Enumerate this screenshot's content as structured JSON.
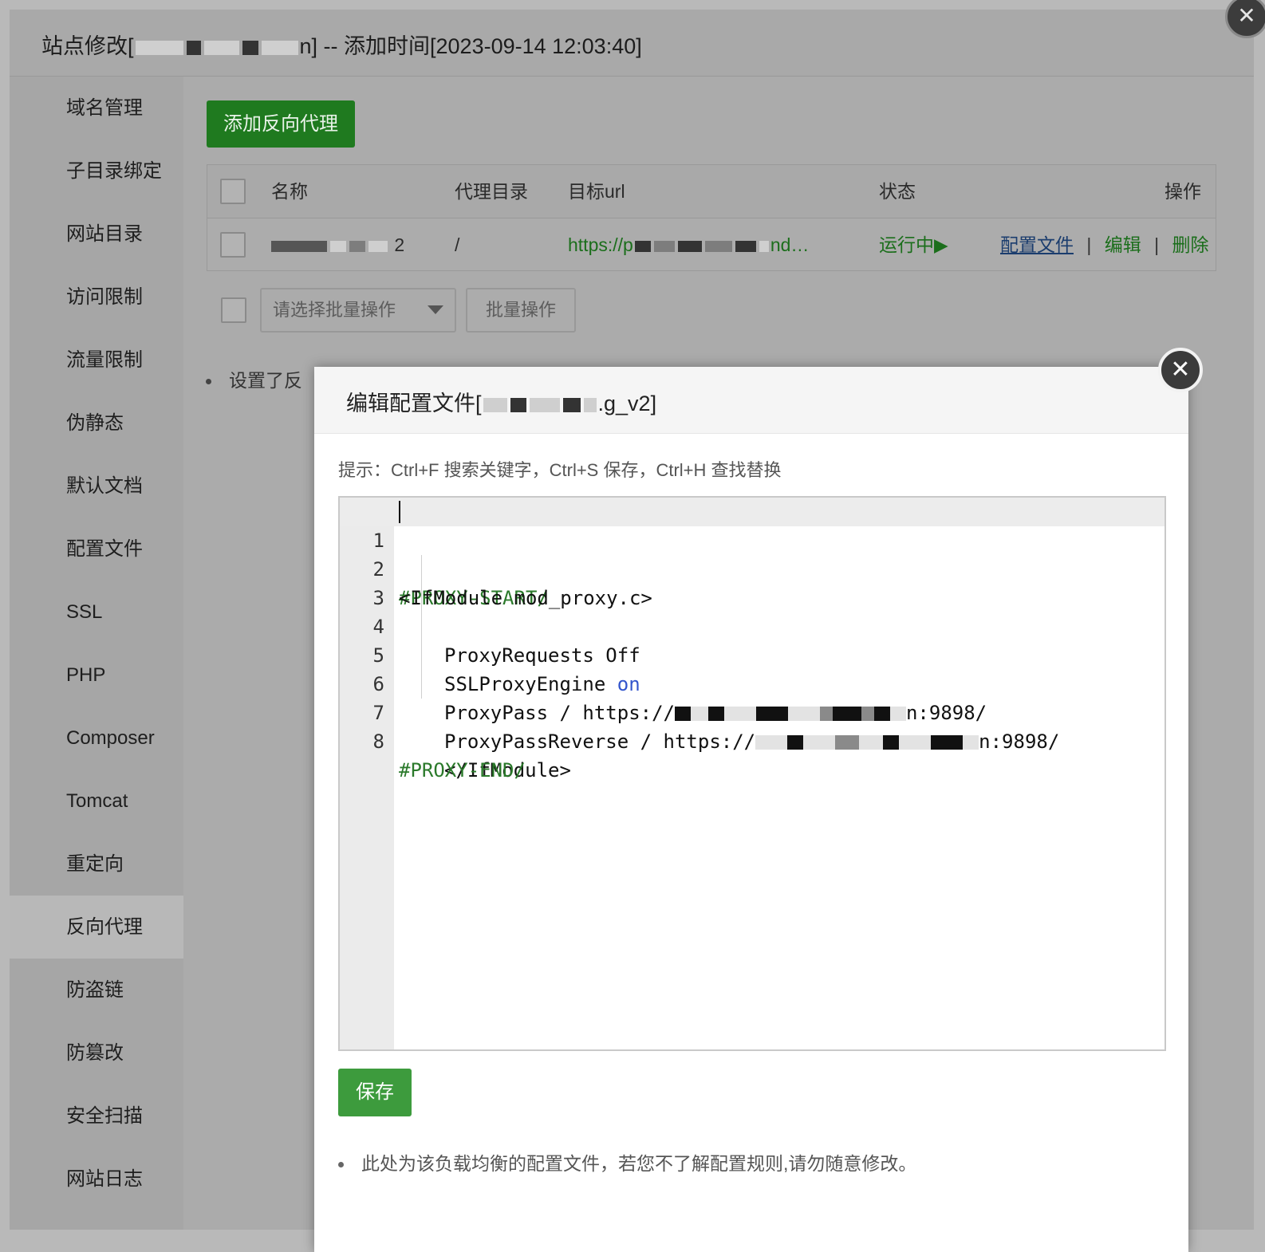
{
  "site_window": {
    "title_prefix": "站点修改[",
    "title_suffix": "n] -- 添加时间[2023-09-14 12:03:40]",
    "close_glyph": "✕"
  },
  "sidebar": {
    "items": [
      {
        "label": "域名管理"
      },
      {
        "label": "子目录绑定"
      },
      {
        "label": "网站目录"
      },
      {
        "label": "访问限制"
      },
      {
        "label": "流量限制"
      },
      {
        "label": "伪静态"
      },
      {
        "label": "默认文档"
      },
      {
        "label": "配置文件"
      },
      {
        "label": "SSL"
      },
      {
        "label": "PHP"
      },
      {
        "label": "Composer"
      },
      {
        "label": "Tomcat"
      },
      {
        "label": "重定向"
      },
      {
        "label": "反向代理"
      },
      {
        "label": "防盗链"
      },
      {
        "label": "防篡改"
      },
      {
        "label": "安全扫描"
      },
      {
        "label": "网站日志"
      }
    ],
    "active": "反向代理"
  },
  "proxy_panel": {
    "add_button": "添加反向代理",
    "table": {
      "columns": [
        "名称",
        "代理目录",
        "目标url",
        "状态",
        "操作"
      ],
      "rows": [
        {
          "name_tail": "2",
          "dir": "/",
          "target_prefix": "https://p",
          "target_suffix": "nd…",
          "status": "运行中▶",
          "actions": {
            "config": "配置文件",
            "edit": "编辑",
            "delete": "删除",
            "sep": "|"
          }
        }
      ]
    },
    "batch_select_placeholder": "请选择批量操作",
    "batch_button": "批量操作",
    "note_partial": "设置了反"
  },
  "modal": {
    "title_prefix": "编辑配置文件[",
    "title_suffix": ".g_v2]",
    "close_glyph": "✕",
    "hint": "提示：Ctrl+F 搜索关键字，Ctrl+S 保存，Ctrl+H 查找替换",
    "code_lines": [
      {
        "n": "1",
        "text": "#PROXY-START/"
      },
      {
        "n": "2",
        "text": "<IfModule mod_proxy.c>"
      },
      {
        "n": "3",
        "text": "ProxyRequests Off"
      },
      {
        "n": "4",
        "text_a": "SSLProxyEngine ",
        "text_b": "on"
      },
      {
        "n": "5",
        "text_a": "ProxyPass / https://",
        "text_b": "n:9898/"
      },
      {
        "n": "6",
        "text_a": "ProxyPassReverse / https://",
        "text_b": "n:9898/"
      },
      {
        "n": "7",
        "text": "</IfModule>"
      },
      {
        "n": "8",
        "text": "#PROXY-END/"
      }
    ],
    "save_button": "保存",
    "footer_note": "此处为该负载均衡的配置文件，若您不了解配置规则,请勿随意修改。"
  },
  "colors": {
    "primary_green": "#3d9b3d",
    "comment_green": "#2b7a2b",
    "keyword_blue": "#3355cc"
  }
}
